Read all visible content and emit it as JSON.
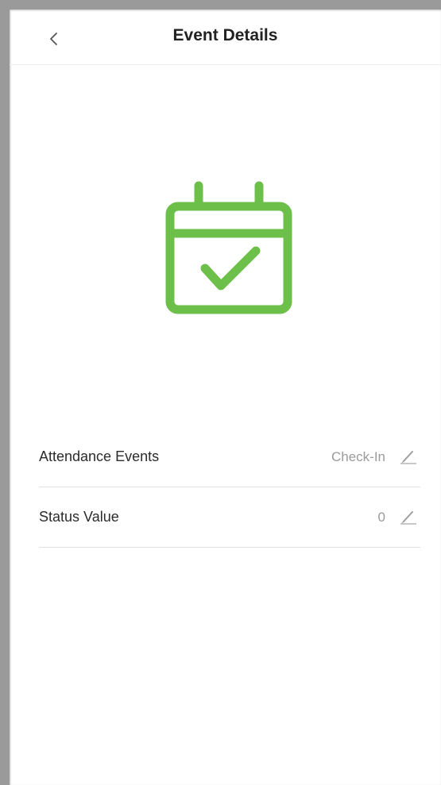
{
  "header": {
    "title": "Event Details",
    "back_icon": "chevron-left-icon"
  },
  "hero": {
    "icon": "calendar-check-icon",
    "color": "#6cc04a"
  },
  "list": {
    "items": [
      {
        "label": "Attendance Events",
        "value": "Check-In",
        "icon": "edit-icon"
      },
      {
        "label": "Status Value",
        "value": "0",
        "icon": "edit-icon"
      }
    ]
  }
}
